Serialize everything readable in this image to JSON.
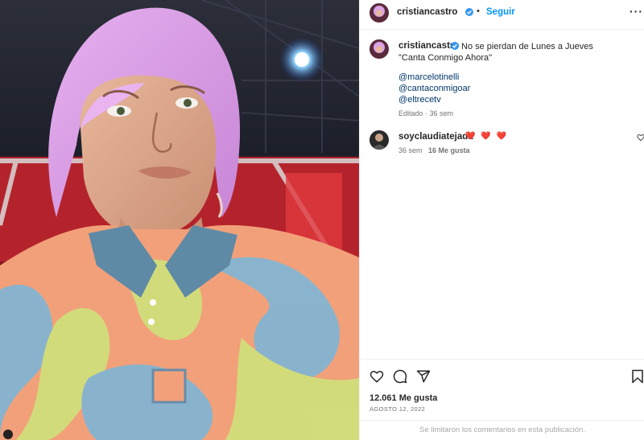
{
  "post": {
    "author": "cristiancastro",
    "follow_label": "Seguir",
    "separator": "•",
    "more_label": "···",
    "caption_text": "No se pierdan de Lunes a Jueves \"Canta Conmigo Ahora\"",
    "mentions": [
      "@marcelotinelli",
      "@cantaconmigoar",
      "@eltrecetv"
    ],
    "edited_meta": "Editado · 36 sem",
    "likes": "12.061 Me gusta",
    "date": "AGOSTO 12, 2022",
    "comments_limited": "Se limitaron los comentarios en esta publicación."
  },
  "comment": {
    "author": "soyclaudiatejada",
    "text": "❤️ ❤️ ❤️",
    "time": "36 sem",
    "likes": "16 Me gusta"
  },
  "colors": {
    "accent": "#0095f6",
    "verified": "#3897f0",
    "link": "#00376b",
    "hair": "#d9a3e6",
    "shirt_orange": "#f2a07a",
    "shirt_green": "#cfe27a",
    "shirt_blue": "#7eb6d6"
  },
  "icons": {
    "like": "heart-outline-icon",
    "comment": "comment-bubble-icon",
    "share": "paper-plane-icon",
    "save": "bookmark-icon",
    "verified": "verified-badge-icon"
  }
}
